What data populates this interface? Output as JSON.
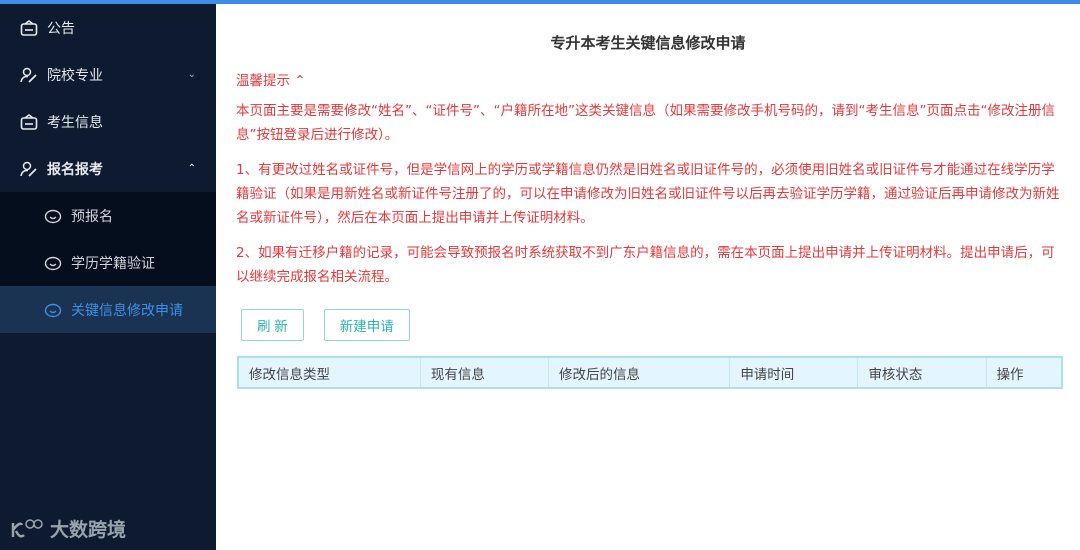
{
  "sidebar": {
    "items": [
      {
        "label": "公告",
        "icon": "notice-icon"
      },
      {
        "label": "院校专业",
        "icon": "user-edit-icon",
        "chevron": "down"
      },
      {
        "label": "考生信息",
        "icon": "notice-icon"
      },
      {
        "label": "报名报考",
        "icon": "user-edit-icon",
        "chevron": "up"
      }
    ],
    "sub_items": [
      {
        "label": "预报名"
      },
      {
        "label": "学历学籍验证"
      },
      {
        "label": "关键信息修改申请",
        "active": true
      }
    ],
    "logo": "大数跨境"
  },
  "main": {
    "title": "专升本考生关键信息修改申请",
    "tip_header": "温馨提示",
    "paragraphs": [
      "本页面主要是需要修改“姓名”、“证件号”、“户籍所在地”这类关键信息（如果需要修改手机号码的，请到“考生信息”页面点击“修改注册信息”按钮登录后进行修改）。",
      "1、有更改过姓名或证件号，但是学信网上的学历或学籍信息仍然是旧姓名或旧证件号的，必须使用旧姓名或旧证件号才能通过在线学历学籍验证（如果是用新姓名或新证件号注册了的，可以在申请修改为旧姓名或旧证件号以后再去验证学历学籍，通过验证后再申请修改为新姓名或新证件号），然后在本页面上提出申请并上传证明材料。",
      "2、如果有迁移户籍的记录，可能会导致预报名时系统获取不到广东户籍信息的，需在本页面上提出申请并上传证明材料。提出申请后，可以继续完成报名相关流程。"
    ],
    "buttons": {
      "refresh": "刷 新",
      "new": "新建申请"
    },
    "table": {
      "columns": [
        "修改信息类型",
        "现有信息",
        "修改后的信息",
        "申请时间",
        "审核状态",
        "操作"
      ]
    }
  },
  "colors": {
    "accent": "#3d8de8",
    "warning": "#e4393c",
    "teal": "#2bb3b0"
  }
}
